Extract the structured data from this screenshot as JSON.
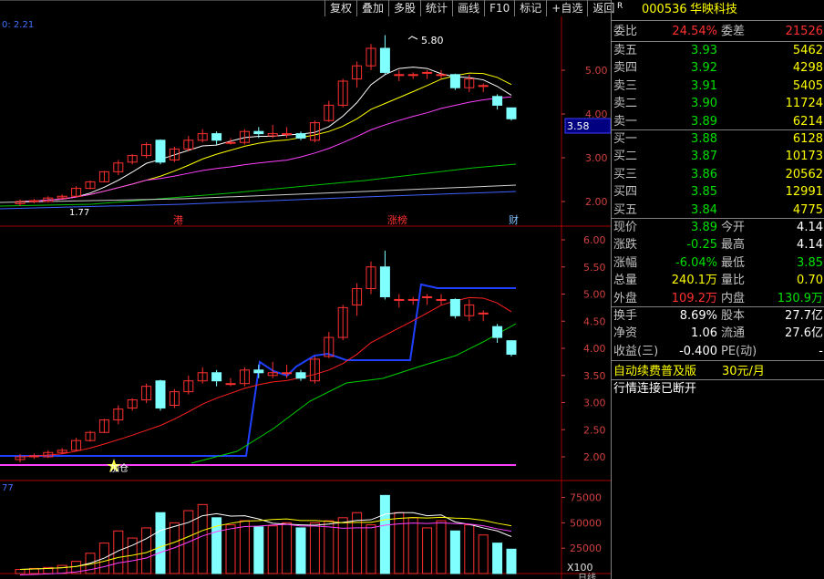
{
  "toolbar": [
    "复权",
    "叠加",
    "多股",
    "统计",
    "画线",
    "F10",
    "标记",
    "+自选",
    "返回"
  ],
  "stock": {
    "r_marker": "R",
    "code": "000536",
    "name": "华映科技"
  },
  "weibi": {
    "label": "委比",
    "value": "24.54%",
    "label2": "委差",
    "value2": "21526"
  },
  "sell": [
    {
      "label": "卖五",
      "price": "3.93",
      "vol": "5462"
    },
    {
      "label": "卖四",
      "price": "3.92",
      "vol": "4298"
    },
    {
      "label": "卖三",
      "price": "3.91",
      "vol": "5405"
    },
    {
      "label": "卖二",
      "price": "3.90",
      "vol": "11724"
    },
    {
      "label": "卖一",
      "price": "3.89",
      "vol": "6214"
    }
  ],
  "buy": [
    {
      "label": "买一",
      "price": "3.88",
      "vol": "6128"
    },
    {
      "label": "买二",
      "price": "3.87",
      "vol": "10173"
    },
    {
      "label": "买三",
      "price": "3.86",
      "vol": "20562"
    },
    {
      "label": "买四",
      "price": "3.85",
      "vol": "12991"
    },
    {
      "label": "买五",
      "price": "3.84",
      "vol": "4775"
    }
  ],
  "stats": [
    {
      "l1": "现价",
      "v1": "3.89",
      "c1": "green",
      "l2": "今开",
      "v2": "4.14",
      "c2": "white"
    },
    {
      "l1": "涨跌",
      "v1": "-0.25",
      "c1": "green",
      "l2": "最高",
      "v2": "4.14",
      "c2": "white"
    },
    {
      "l1": "涨幅",
      "v1": "-6.04%",
      "c1": "green",
      "l2": "最低",
      "v2": "3.85",
      "c2": "green"
    },
    {
      "l1": "总量",
      "v1": "240.1万",
      "c1": "yellow",
      "l2": "量比",
      "v2": "0.70",
      "c2": "yellow"
    },
    {
      "l1": "外盘",
      "v1": "109.2万",
      "c1": "red",
      "l2": "内盘",
      "v2": "130.9万",
      "c2": "green"
    }
  ],
  "stats2": [
    {
      "l1": "换手",
      "v1": "8.69%",
      "l2": "股本",
      "v2": "27.7亿"
    },
    {
      "l1": "净资",
      "v1": "1.06",
      "l2": "流通",
      "v2": "27.6亿"
    },
    {
      "l1": "收益(三)",
      "v1": "-0.400",
      "l2": "PE(动)",
      "v2": "-"
    }
  ],
  "promo": {
    "text": "自动续费普及版",
    "price": "30元/月"
  },
  "status_text": "行情连接已断开",
  "chart": {
    "top_label": "0: 2.21",
    "high_label": "5.80",
    "low_label": "1.77",
    "current_price_tag": "3.58",
    "upper_ticks": [
      "5.00",
      "4.00",
      "3.00",
      "2.00"
    ],
    "mid_ticks": [
      "6.00",
      "5.50",
      "5.00",
      "4.50",
      "4.00",
      "3.50",
      "3.00",
      "2.50",
      "2.00"
    ],
    "vol_ticks": [
      "75000",
      "50000",
      "25000"
    ],
    "vol_unit": "X100",
    "vol_top_label": "77",
    "markers": [
      "港",
      "涨榜",
      "财"
    ],
    "buy_marker": "加仓",
    "bottom_tab": "日线"
  },
  "chart_data": {
    "type": "candlestick",
    "candles": [
      {
        "o": 1.95,
        "c": 2.0,
        "h": 2.05,
        "l": 1.9
      },
      {
        "o": 2.0,
        "c": 2.02,
        "h": 2.06,
        "l": 1.96
      },
      {
        "o": 2.0,
        "c": 2.08,
        "h": 2.12,
        "l": 1.98
      },
      {
        "o": 2.08,
        "c": 2.12,
        "h": 2.16,
        "l": 2.05
      },
      {
        "o": 2.12,
        "c": 2.3,
        "h": 2.35,
        "l": 2.1
      },
      {
        "o": 2.3,
        "c": 2.45,
        "h": 2.48,
        "l": 2.28
      },
      {
        "o": 2.45,
        "c": 2.68,
        "h": 2.7,
        "l": 2.44
      },
      {
        "o": 2.68,
        "c": 2.88,
        "h": 2.95,
        "l": 2.6
      },
      {
        "o": 2.9,
        "c": 3.05,
        "h": 3.08,
        "l": 2.85
      },
      {
        "o": 3.05,
        "c": 3.3,
        "h": 3.35,
        "l": 2.99
      },
      {
        "o": 3.4,
        "c": 2.9,
        "h": 3.42,
        "l": 2.85
      },
      {
        "o": 2.95,
        "c": 3.2,
        "h": 3.25,
        "l": 2.9
      },
      {
        "o": 3.2,
        "c": 3.4,
        "h": 3.5,
        "l": 3.15
      },
      {
        "o": 3.4,
        "c": 3.55,
        "h": 3.65,
        "l": 3.35
      },
      {
        "o": 3.55,
        "c": 3.4,
        "h": 3.6,
        "l": 3.3
      },
      {
        "o": 3.35,
        "c": 3.35,
        "h": 3.45,
        "l": 3.3
      },
      {
        "o": 3.35,
        "c": 3.6,
        "h": 3.65,
        "l": 3.3
      },
      {
        "o": 3.6,
        "c": 3.55,
        "h": 3.7,
        "l": 3.45
      },
      {
        "o": 3.5,
        "c": 3.55,
        "h": 3.75,
        "l": 3.45
      },
      {
        "o": 3.55,
        "c": 3.55,
        "h": 3.7,
        "l": 3.45
      },
      {
        "o": 3.55,
        "c": 3.45,
        "h": 3.6,
        "l": 3.4
      },
      {
        "o": 3.4,
        "c": 3.8,
        "h": 3.85,
        "l": 3.35
      },
      {
        "o": 3.85,
        "c": 4.2,
        "h": 4.3,
        "l": 3.82
      },
      {
        "o": 4.2,
        "c": 4.75,
        "h": 4.8,
        "l": 4.15
      },
      {
        "o": 4.8,
        "c": 5.1,
        "h": 5.2,
        "l": 4.6
      },
      {
        "o": 5.1,
        "c": 5.5,
        "h": 5.6,
        "l": 5.0
      },
      {
        "o": 5.5,
        "c": 4.95,
        "h": 5.8,
        "l": 4.9
      },
      {
        "o": 4.9,
        "c": 4.9,
        "h": 5.0,
        "l": 4.75
      },
      {
        "o": 4.9,
        "c": 4.9,
        "h": 4.95,
        "l": 4.8
      },
      {
        "o": 4.95,
        "c": 4.95,
        "h": 5.0,
        "l": 4.8
      },
      {
        "o": 4.9,
        "c": 4.9,
        "h": 5.0,
        "l": 4.8
      },
      {
        "o": 4.9,
        "c": 4.6,
        "h": 4.92,
        "l": 4.55
      },
      {
        "o": 4.6,
        "c": 4.8,
        "h": 4.9,
        "l": 4.5
      },
      {
        "o": 4.65,
        "c": 4.65,
        "h": 4.7,
        "l": 4.5
      },
      {
        "o": 4.4,
        "c": 4.2,
        "h": 4.45,
        "l": 4.1
      },
      {
        "o": 4.14,
        "c": 3.89,
        "h": 4.14,
        "l": 3.85
      }
    ],
    "volumes": [
      4000,
      5000,
      6000,
      8000,
      12000,
      20000,
      30000,
      42000,
      35000,
      45000,
      60000,
      50000,
      62000,
      68000,
      55000,
      48000,
      52000,
      46000,
      47000,
      50000,
      45000,
      50000,
      52000,
      55000,
      60000,
      48000,
      77000,
      60000,
      55000,
      45000,
      52000,
      42000,
      48000,
      38000,
      30000,
      24000
    ]
  }
}
